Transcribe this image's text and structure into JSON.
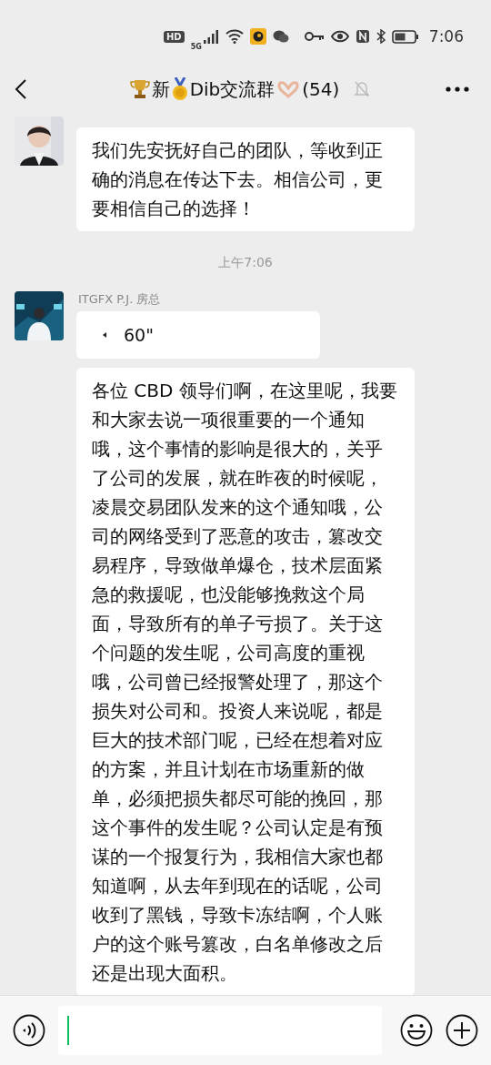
{
  "status_bar": {
    "badge": "HD",
    "network": "5G",
    "time": "7:06"
  },
  "header": {
    "title_parts": [
      "新",
      "Dib交流群",
      "(54)"
    ],
    "muted": true
  },
  "messages": [
    {
      "kind": "text",
      "text": "我们先安抚好自己的团队，等收到正确的消息在传达下去。相信公司，更要相信自己的选择！"
    },
    {
      "kind": "time",
      "text": "上午7:06"
    },
    {
      "kind": "voice",
      "sender": "ITGFX P.J. 房总",
      "duration": "60\""
    },
    {
      "kind": "text",
      "text": "各位 CBD 领导们啊，在这里呢，我要和大家去说一项很重要的一个通知哦，这个事情的影响是很大的，关乎了公司的发展，就在昨夜的时候呢，凌晨交易团队发来的这个通知哦，公司的网络受到了恶意的攻击，篡改交易程序，导致做单爆仓，技术层面紧急的救援呢，也没能够挽救这个局面，导致所有的单子亏损了。关于这个问题的发生呢，公司高度的重视哦，公司曾已经报警处理了，那这个损失对公司和。投资人来说呢，都是巨大的技术部门呢，已经在想着对应的方案，并且计划在市场重新的做单，必须把损失都尽可能的挽回，那这个事件的发生呢？公司认定是有预谋的一个报复行为，我相信大家也都知道啊，从去年到现在的话呢，公司收到了黑钱，导致卡冻结啊，个人账户的这个账号篡改，白名单修改之后还是出现大面积。",
      "continued": true
    }
  ]
}
